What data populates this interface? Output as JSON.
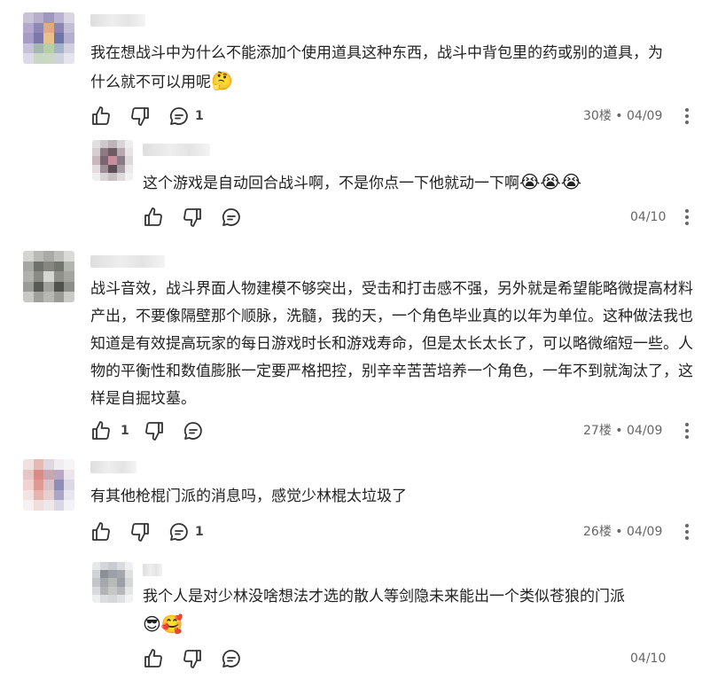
{
  "comments": [
    {
      "text": "我在想战斗中为什么不能添加个使用道具这种东西，战斗中背包里的药或别的道具，为什么就不可以用呢",
      "emoji": "🤔",
      "reply_count": "1",
      "floor": "30楼",
      "dot": "•",
      "date": "04/09"
    },
    {
      "text": "这个游戏是自动回合战斗啊，不是你点一下他就动一下啊",
      "emoji": "😭😭😭",
      "date": "04/10"
    },
    {
      "text": "战斗音效，战斗界面人物建模不够突出，受击和打击感不强，另外就是希望能略微提高材料产出，不要像隔壁那个顺脉，洗髓，我的天，一个角色毕业真的以年为单位。这种做法我也知道是有效提高玩家的每日游戏时长和游戏寿命，但是太长太长了，可以略微缩短一些。人物的平衡性和数值膨胀一定要严格把控，别辛辛苦苦培养一个角色，一年不到就淘汰了，这样是自掘坟墓。",
      "like_count": "1",
      "floor": "27楼",
      "dot": "•",
      "date": "04/09"
    },
    {
      "text": "有其他枪棍门派的消息吗，感觉少林棍太垃圾了",
      "reply_count": "1",
      "floor": "26楼",
      "dot": "•",
      "date": "04/09"
    },
    {
      "text": "我个人是对少林没啥想法才选的散人等剑隐未来能出一个类似苍狼的门派",
      "emoji": "😎🥰",
      "date": "04/10"
    }
  ]
}
